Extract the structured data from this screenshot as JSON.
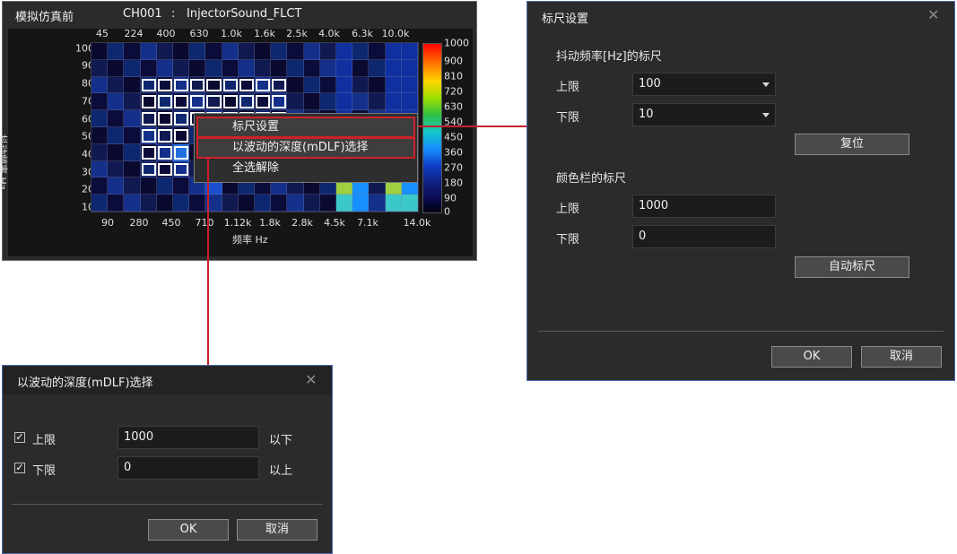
{
  "simulation": {
    "title": "模拟仿真前",
    "channel": "CH001",
    "separator": ":",
    "signal_name": "InjectorSound_FLCT",
    "top_axis_ticks": [
      "45",
      "224",
      "400",
      "630",
      "1.0k",
      "1.6k",
      "2.5k",
      "4.0k",
      "6.3k",
      "10.0k"
    ],
    "x_axis_ticks": [
      "90",
      "280",
      "450",
      "710",
      "1.12k",
      "1.8k",
      "2.8k",
      "4.5k",
      "7.1k",
      "14.0k"
    ],
    "x_axis_label": "频率 Hz",
    "y_axis_ticks": [
      "100",
      "90",
      "80",
      "70",
      "60",
      "50",
      "40",
      "30",
      "20",
      "10"
    ],
    "y_axis_label": "抖动频率 Hz",
    "colorbar_ticks": [
      "1000",
      "900",
      "810",
      "720",
      "630",
      "540",
      "450",
      "360",
      "270",
      "180",
      "90",
      "0"
    ]
  },
  "context_menu": {
    "items": [
      {
        "label": "标尺设置"
      },
      {
        "label": "以波动的深度(mDLF)选择"
      },
      {
        "label": "全选解除"
      }
    ]
  },
  "scale_dialog": {
    "title": "标尺设置",
    "close_icon": "close-icon",
    "section_freq": "抖动频率[Hz]的标尺",
    "upper_label": "上限",
    "upper_value": "100",
    "lower_label": "下限",
    "lower_value": "10",
    "reset_button": "复位",
    "section_color": "颜色栏的标尺",
    "color_upper_label": "上限",
    "color_upper_value": "1000",
    "color_lower_label": "下限",
    "color_lower_value": "0",
    "auto_button": "自动标尺",
    "ok_button": "OK",
    "cancel_button": "取消"
  },
  "depth_dialog": {
    "title": "以波动的深度(mDLF)选择",
    "close_icon": "close-icon",
    "upper_checked": true,
    "upper_label": "上限",
    "upper_value": "1000",
    "upper_suffix": "以下",
    "lower_checked": true,
    "lower_label": "下限",
    "lower_value": "0",
    "lower_suffix": "以上",
    "ok_button": "OK",
    "cancel_button": "取消"
  },
  "colors": {
    "accent_red": "#c8202a",
    "window_bg": "#2b2b2b",
    "dialog_border": "#4a6fb0"
  }
}
